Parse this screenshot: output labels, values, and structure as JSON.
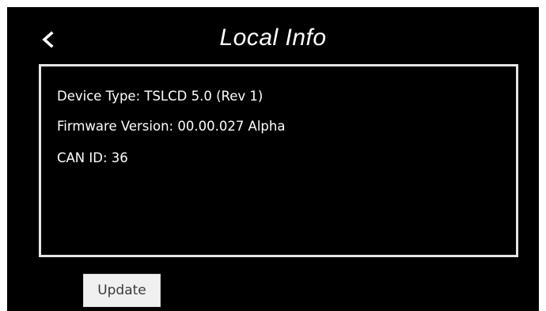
{
  "header": {
    "title": "Local Info",
    "back_icon": "chevron-left-icon"
  },
  "info": {
    "device_type": "Device Type: TSLCD 5.0 (Rev 1)",
    "firmware_version": "Firmware Version: 00.00.027 Alpha",
    "can_id": "CAN ID: 36"
  },
  "actions": {
    "update_label": "Update"
  },
  "colors": {
    "background": "#000000",
    "text": "#ffffff",
    "panel_border": "#e6e6e6",
    "button_background": "#f0f0f0",
    "button_text": "#3a3a3a"
  }
}
